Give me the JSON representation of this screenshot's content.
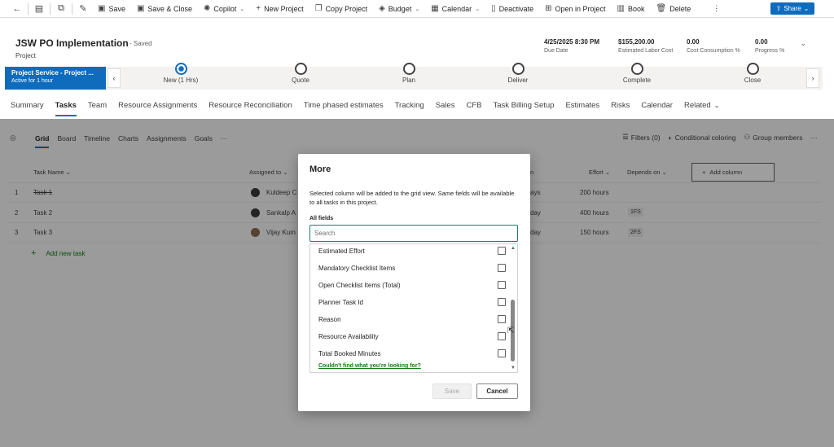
{
  "commandbar": {
    "items": [
      {
        "label": "Save",
        "icon": "save-icon"
      },
      {
        "label": "Save & Close",
        "icon": "save-close-icon"
      },
      {
        "label": "Copilot",
        "icon": "copilot-icon",
        "dropdown": true
      },
      {
        "label": "New Project",
        "icon": "plus-icon"
      },
      {
        "label": "Copy Project",
        "icon": "copy-icon"
      },
      {
        "label": "Budget",
        "icon": "budget-icon",
        "dropdown": true
      },
      {
        "label": "Calendar",
        "icon": "calendar-icon",
        "dropdown": true
      },
      {
        "label": "Deactivate",
        "icon": "deactivate-icon"
      },
      {
        "label": "Open in Project",
        "icon": "open-project-icon"
      },
      {
        "label": "Book",
        "icon": "book-icon"
      },
      {
        "label": "Delete",
        "icon": "trash-icon"
      }
    ],
    "share_label": "Share"
  },
  "header": {
    "title": "JSW PO Implementation",
    "saved": "- Saved",
    "entity": "Project",
    "fields": [
      {
        "value": "4/25/2025 8:30 PM",
        "label": "Due Date"
      },
      {
        "value": "$155,200.00",
        "label": "Estimated Labor Cost"
      },
      {
        "value": "0.00",
        "label": "Cost Consumption %"
      },
      {
        "value": "0.00",
        "label": "Progress %"
      }
    ]
  },
  "bpf": {
    "active_title": "Project Service - Project ...",
    "active_sub": "Active for 1 hour",
    "stages": [
      "New  (1 Hrs)",
      "Quote",
      "Plan",
      "Deliver",
      "Complete",
      "Close"
    ]
  },
  "tabs": [
    "Summary",
    "Tasks",
    "Team",
    "Resource Assignments",
    "Resource Reconciliation",
    "Time phased estimates",
    "Tracking",
    "Sales",
    "CFB",
    "Task Billing Setup",
    "Estimates",
    "Risks",
    "Calendar",
    "Related"
  ],
  "grid": {
    "views": [
      "Grid",
      "Board",
      "Timeline",
      "Charts",
      "Assignments",
      "Goals"
    ],
    "tools": {
      "filters": "Filters (0)",
      "coloring": "Conditional coloring",
      "members": "Group members"
    },
    "columns": {
      "name": "Task Name",
      "assigned": "Assigned to",
      "effort": "Effort",
      "depends": "Depends on",
      "add": "Add column",
      "duration_tail": "n"
    },
    "rows": [
      {
        "num": "1",
        "name": "Task 1",
        "assigned": "Kuldeep C",
        "duration": "ays",
        "effort": "200 hours",
        "depends": ""
      },
      {
        "num": "2",
        "name": "Task 2",
        "assigned": "Sankalp A",
        "duration": "day",
        "effort": "400 hours",
        "depends": "1FS"
      },
      {
        "num": "3",
        "name": "Task 3",
        "assigned": "Vijay Kum",
        "duration": "day",
        "effort": "150 hours",
        "depends": "2FS"
      }
    ],
    "add_task": "Add new task"
  },
  "dialog": {
    "title": "More",
    "description": "Selected column will be added to the grid view. Same fields will be available to all tasks in this project.",
    "section": "All fields",
    "search_placeholder": "Search",
    "options": [
      "Estimated Effort",
      "Mandatory Checklist Items",
      "Open Checklist Items (Total)",
      "Planner Task Id",
      "Reason",
      "Resource Availability",
      "Total Booked Minutes"
    ],
    "help_link": "Couldn't find what you're looking for?",
    "save_label": "Save",
    "cancel_label": "Cancel"
  }
}
